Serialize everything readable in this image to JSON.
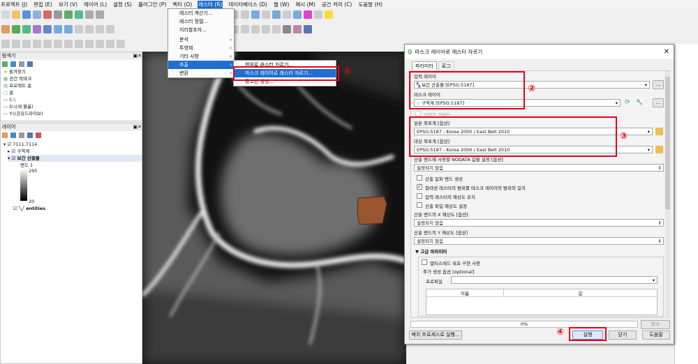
{
  "menubar": [
    "프로젝트 (J)",
    "편집 (E)",
    "보기 (V)",
    "레이어 (L)",
    "설정 (S)",
    "플러그인 (P)",
    "벡터 (O)",
    "래스터 (R)",
    "데이터베이스 (D)",
    "웹 (W)",
    "메시 (M)",
    "공간 처리 (C)",
    "도움말 (H)"
  ],
  "raster_menu": {
    "items": [
      {
        "label": "래스터 계산기...",
        "submenu": false
      },
      {
        "label": "래스터 정렬...",
        "submenu": false
      },
      {
        "label": "지리참조자...",
        "submenu": false
      },
      {
        "label": "분석",
        "submenu": true
      },
      {
        "label": "투영체",
        "submenu": true
      },
      {
        "label": "기타 사항",
        "submenu": true
      },
      {
        "label": "추출",
        "submenu": true
      },
      {
        "label": "변환",
        "submenu": true
      }
    ],
    "extract_submenu": [
      "범위로 래스터 자르기...",
      "마스크 레이어로 래스터 자르기...",
      "등고선 생성..."
    ]
  },
  "browser_panel": {
    "title": "탐색기",
    "items": [
      "즐겨찾기",
      "공간 북마크",
      "프로젝트 홈",
      "홈",
      "C:\\",
      "D:\\(새 볼륨)",
      "Y:\\(공유드라이브)"
    ]
  },
  "layers_panel": {
    "title": "레이어",
    "items": [
      "7111,7114",
      "구역계",
      "보간 산출물",
      "밴드 1",
      "295",
      "20",
      "entities"
    ]
  },
  "dialog": {
    "title": "마스크 레이어로 래스터 자르기",
    "tabs": [
      "파라미터",
      "로그"
    ],
    "input_layer_label": "입력 레이어",
    "input_layer_value": "보간 산출물 [EPSG:5187]",
    "mask_layer_label": "마스크 레이어",
    "mask_layer_value": "구역계 [EPSG:5187]",
    "selected_only": "선택한 객체만",
    "source_crs_label": "원본 좌표계 [옵션]",
    "source_crs_value": "EPSG:5187 - Korea 2000 / East Belt 2010",
    "target_crs_label": "대상 좌표계 [옵션]",
    "target_crs_value": "EPSG:5187 - Korea 2000 / East Belt 2010",
    "nodata_label": "산출 밴드에 사용할 NODATA 값을 설정 [옵션]",
    "nodata_value": "설정되지 않음",
    "alpha_band": "산출 알파 밴드 생성",
    "match_extent": "잘라낸 래스터의 범위를 마스크 레이어의 범위와 일치",
    "keep_resolution": "입력 래스터의 해상도 유지",
    "set_resolution": "산출 파일 해상도 설정",
    "x_res_label": "산출 밴드의 X 해상도 [옵션]",
    "x_res_value": "설정되지 않음",
    "y_res_label": "산출 밴드의 Y 해상도 [옵션]",
    "y_res_value": "설정되지 않음",
    "advanced": "고급 파라미터",
    "multithread": "멀티스레드 워프 구현 사용",
    "extra_options": "추가 생성 옵션 [optional]",
    "profile_label": "프로파일",
    "table_headers": [
      "이름",
      "값"
    ],
    "progress": "0%",
    "progress_value": 0,
    "cancel": "취소",
    "batch": "배치 프로세스로 실행...",
    "run": "실행",
    "close": "닫기",
    "help": "도움말"
  },
  "annotations": [
    "①",
    "②",
    "③",
    "④"
  ]
}
